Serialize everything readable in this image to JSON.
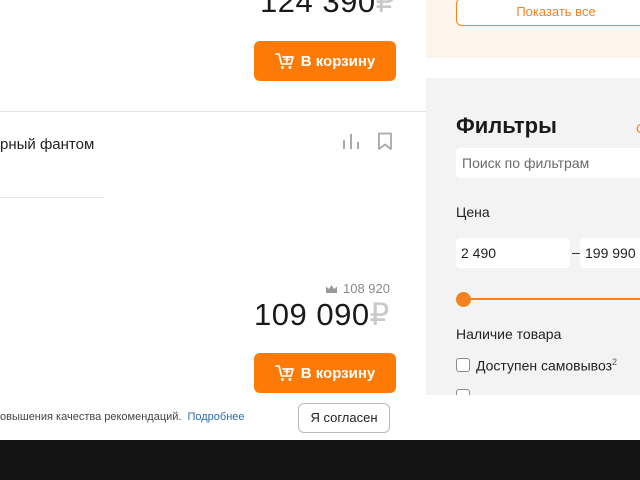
{
  "top_product": {
    "price": "124 390",
    "currency": "₽",
    "cart_label": "В корзину"
  },
  "side_panel": {
    "show_all_label": "Показать все"
  },
  "product": {
    "title_fragment": "рный фантом",
    "old_price": "108 920",
    "price": "109 090",
    "currency": "₽",
    "cart_label": "В корзину"
  },
  "filters": {
    "title": "Фильтры",
    "reset_fragment": "С",
    "search_placeholder": "Поиск по фильтрам",
    "price_label": "Цена",
    "price_from": "2 490",
    "price_dash": "–",
    "price_to": "199 990",
    "availability_label": "Наличие товара",
    "pickup_label": "Доступен самовывоз",
    "pickup_sup": "2"
  },
  "cookie": {
    "text": "овышения качества рекомендаций.",
    "link": "Подробнее",
    "agree_label": "Я согласен"
  },
  "colors": {
    "accent": "#fc7a05",
    "filters_bg": "#f3f3f3",
    "link": "#2b6cb0"
  }
}
